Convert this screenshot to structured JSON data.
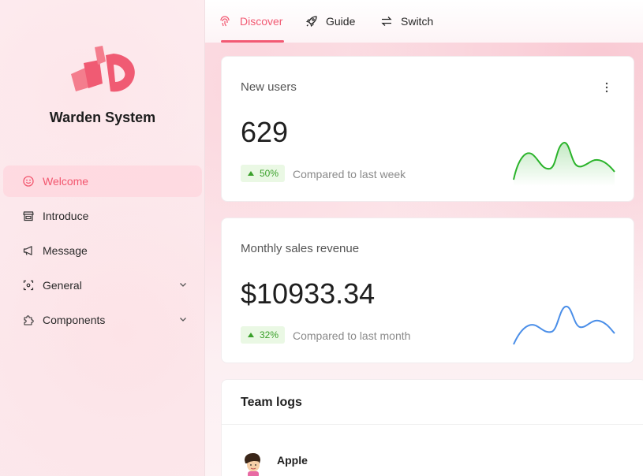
{
  "app": {
    "title": "Warden System"
  },
  "sidebar": {
    "items": [
      {
        "label": "Welcome",
        "icon": "smile-icon",
        "active": true
      },
      {
        "label": "Introduce",
        "icon": "shop-icon"
      },
      {
        "label": "Message",
        "icon": "megaphone-icon"
      },
      {
        "label": "General",
        "icon": "scan-icon",
        "expandable": true
      },
      {
        "label": "Components",
        "icon": "puzzle-icon",
        "expandable": true
      }
    ]
  },
  "topnav": {
    "tabs": [
      {
        "label": "Discover",
        "icon": "fingerprint-icon",
        "active": true
      },
      {
        "label": "Guide",
        "icon": "rocket-icon"
      },
      {
        "label": "Switch",
        "icon": "swap-icon"
      }
    ]
  },
  "cards": {
    "new_users": {
      "title": "New users",
      "value": "629",
      "change": "50%",
      "compare": "Compared to last week",
      "trend_color": "#2ab32a"
    },
    "revenue": {
      "title": "Monthly sales revenue",
      "value": "$10933.34",
      "change": "32%",
      "compare": "Compared to last month",
      "trend_color": "#4a8ee8"
    }
  },
  "team_logs": {
    "title": "Team logs",
    "entries": [
      {
        "name": "Apple"
      }
    ]
  },
  "colors": {
    "accent": "#f25a73",
    "positive": "#3aa02a",
    "positive_bg": "#eaf8e4"
  }
}
